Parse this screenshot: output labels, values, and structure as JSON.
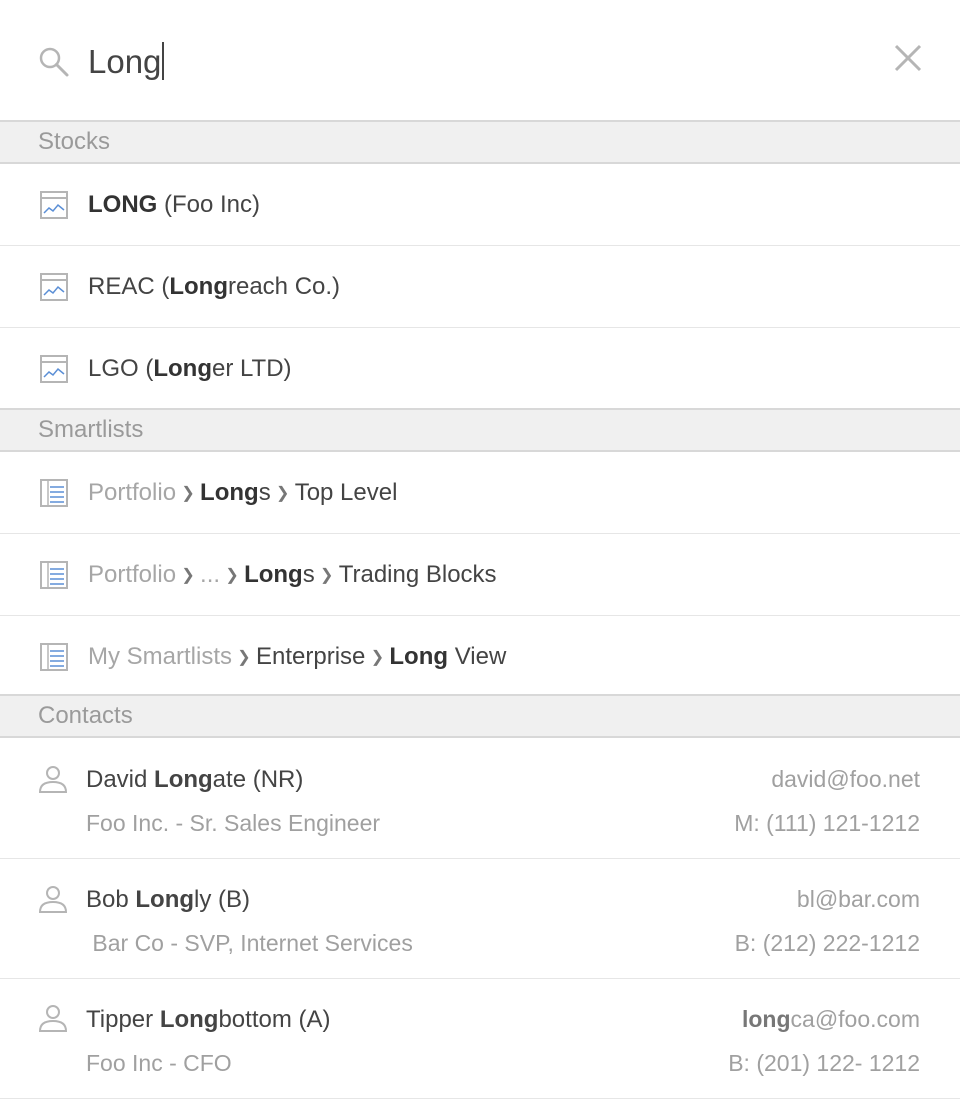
{
  "search": {
    "query": "Long",
    "icon": "search-icon",
    "close_icon": "close-icon"
  },
  "sections": {
    "stocks": "Stocks",
    "smartlists": "Smartlists",
    "contacts": "Contacts"
  },
  "stocks": [
    {
      "pre": "",
      "bold": "LONG",
      "post": " (Foo Inc)"
    },
    {
      "pre": "REAC (",
      "bold": "Long",
      "post": "reach Co.)"
    },
    {
      "pre": "LGO (",
      "bold": "Long",
      "post": "er LTD)"
    }
  ],
  "smartlists": [
    {
      "c1": "Portfolio",
      "c2bold": "Long",
      "c2rest": "s",
      "c3": "Top Level"
    },
    {
      "c1": "Portfolio",
      "c1b": "...",
      "c2bold": "Long",
      "c2rest": "s",
      "c3": "Trading Blocks"
    },
    {
      "c1": "My Smartlists",
      "c2": "Enterprise",
      "c3bold": "Long",
      "c3rest": " View"
    }
  ],
  "contacts": [
    {
      "first": "David ",
      "bold": "Long",
      "rest": "ate (NR)",
      "sub": "Foo Inc. - Sr. Sales Engineer",
      "email": "david@foo.net",
      "phone": "M: (111) 121-1212"
    },
    {
      "first": "Bob ",
      "bold": "Long",
      "rest": "ly (B)",
      "sub": " Bar Co - SVP, Internet Services",
      "email": "bl@bar.com",
      "phone": "B: (212) 222-1212"
    },
    {
      "first": "Tipper ",
      "bold": "Long",
      "rest": "bottom (A)",
      "sub": "Foo Inc - CFO",
      "email_bold": "long",
      "email_rest": "ca@foo.com",
      "phone": "B: (201) 122- 1212"
    }
  ],
  "colors": {
    "accent": "#5b8fd6",
    "header_bg": "#f0f0f0",
    "muted": "#a0a0a0"
  }
}
